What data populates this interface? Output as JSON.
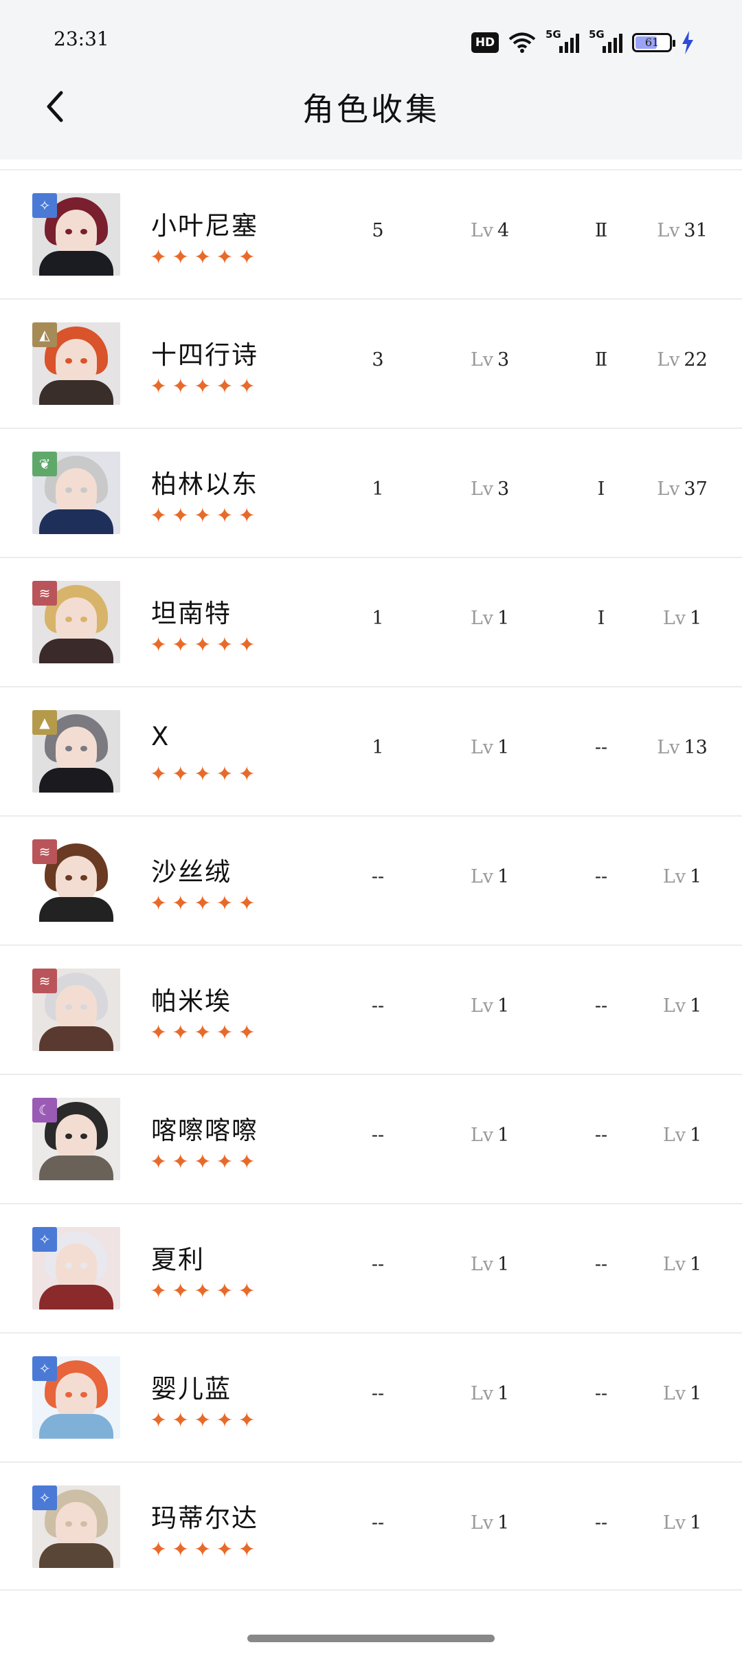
{
  "status": {
    "time": "23:31",
    "hd": "HD",
    "net1": "5G",
    "net2": "5G",
    "battery": "61"
  },
  "header": {
    "title": "角色收集"
  },
  "colors": {
    "star": "#e86a2a"
  },
  "rows": [
    {
      "name": "小叶尼塞",
      "badge_icon": "diamond-icon",
      "badge_color": "#4a7ad6",
      "stars": "✦✦✦✦✦",
      "c1": "5",
      "c2_prefix": "Lv",
      "c2": "4",
      "c3": "Ⅱ",
      "c4_prefix": "Lv",
      "c4": "31",
      "hair": "#7a1f2e",
      "outfit": "#1b1b22"
    },
    {
      "name": "十四行诗",
      "badge_icon": "bag-icon",
      "badge_color": "#a68b57",
      "stars": "✦✦✦✦✦",
      "c1": "3",
      "c2_prefix": "Lv",
      "c2": "3",
      "c3": "Ⅱ",
      "c4_prefix": "Lv",
      "c4": "22",
      "hair": "#d9532b",
      "outfit": "#3a2e2a"
    },
    {
      "name": "柏林以东",
      "badge_icon": "leaf-icon",
      "badge_color": "#5fa86a",
      "stars": "✦✦✦✦✦",
      "c1": "1",
      "c2_prefix": "Lv",
      "c2": "3",
      "c3": "Ⅰ",
      "c4_prefix": "Lv",
      "c4": "37",
      "hair": "#c9c9c9",
      "outfit": "#1e2f5a"
    },
    {
      "name": "坦南特",
      "badge_icon": "claw-icon",
      "badge_color": "#b9555a",
      "stars": "✦✦✦✦✦",
      "c1": "1",
      "c2_prefix": "Lv",
      "c2": "1",
      "c3": "Ⅰ",
      "c4_prefix": "Lv",
      "c4": "1",
      "hair": "#d7b46a",
      "outfit": "#3b2a2a"
    },
    {
      "name": "X",
      "badge_icon": "pyramid-icon",
      "badge_color": "#b49a4a",
      "stars": "✦✦✦✦✦",
      "c1": "1",
      "c2_prefix": "Lv",
      "c2": "1",
      "c3": "--",
      "c4_prefix": "Lv",
      "c4": "13",
      "hair": "#7a7a80",
      "outfit": "#1a1a1f"
    },
    {
      "name": "沙丝绒",
      "badge_icon": "claw-icon",
      "badge_color": "#b9555a",
      "stars": "✦✦✦✦✦",
      "c1": "--",
      "c2_prefix": "Lv",
      "c2": "1",
      "c3": "--",
      "c4_prefix": "Lv",
      "c4": "1",
      "hair": "#6a3b22",
      "outfit": "#222"
    },
    {
      "name": "帕米埃",
      "badge_icon": "claw-icon",
      "badge_color": "#b9555a",
      "stars": "✦✦✦✦✦",
      "c1": "--",
      "c2_prefix": "Lv",
      "c2": "1",
      "c3": "--",
      "c4_prefix": "Lv",
      "c4": "1",
      "hair": "#d8d8dc",
      "outfit": "#5a3a30"
    },
    {
      "name": "喀嚓喀嚓",
      "badge_icon": "moon-icon",
      "badge_color": "#9a5bb5",
      "stars": "✦✦✦✦✦",
      "c1": "--",
      "c2_prefix": "Lv",
      "c2": "1",
      "c3": "--",
      "c4_prefix": "Lv",
      "c4": "1",
      "hair": "#2a2a2a",
      "outfit": "#6a6258"
    },
    {
      "name": "夏利",
      "badge_icon": "diamond-icon",
      "badge_color": "#4a7ad6",
      "stars": "✦✦✦✦✦",
      "c1": "--",
      "c2_prefix": "Lv",
      "c2": "1",
      "c3": "--",
      "c4_prefix": "Lv",
      "c4": "1",
      "hair": "#e8e8ee",
      "outfit": "#8a2a2a"
    },
    {
      "name": "婴儿蓝",
      "badge_icon": "diamond-icon",
      "badge_color": "#4a7ad6",
      "stars": "✦✦✦✦✦",
      "c1": "--",
      "c2_prefix": "Lv",
      "c2": "1",
      "c3": "--",
      "c4_prefix": "Lv",
      "c4": "1",
      "hair": "#e8643a",
      "outfit": "#7fb0d8"
    },
    {
      "name": "玛蒂尔达",
      "badge_icon": "diamond-icon",
      "badge_color": "#4a7ad6",
      "stars": "✦✦✦✦✦",
      "c1": "--",
      "c2_prefix": "Lv",
      "c2": "1",
      "c3": "--",
      "c4_prefix": "Lv",
      "c4": "1",
      "hair": "#cdbfa6",
      "outfit": "#5a4636"
    }
  ]
}
